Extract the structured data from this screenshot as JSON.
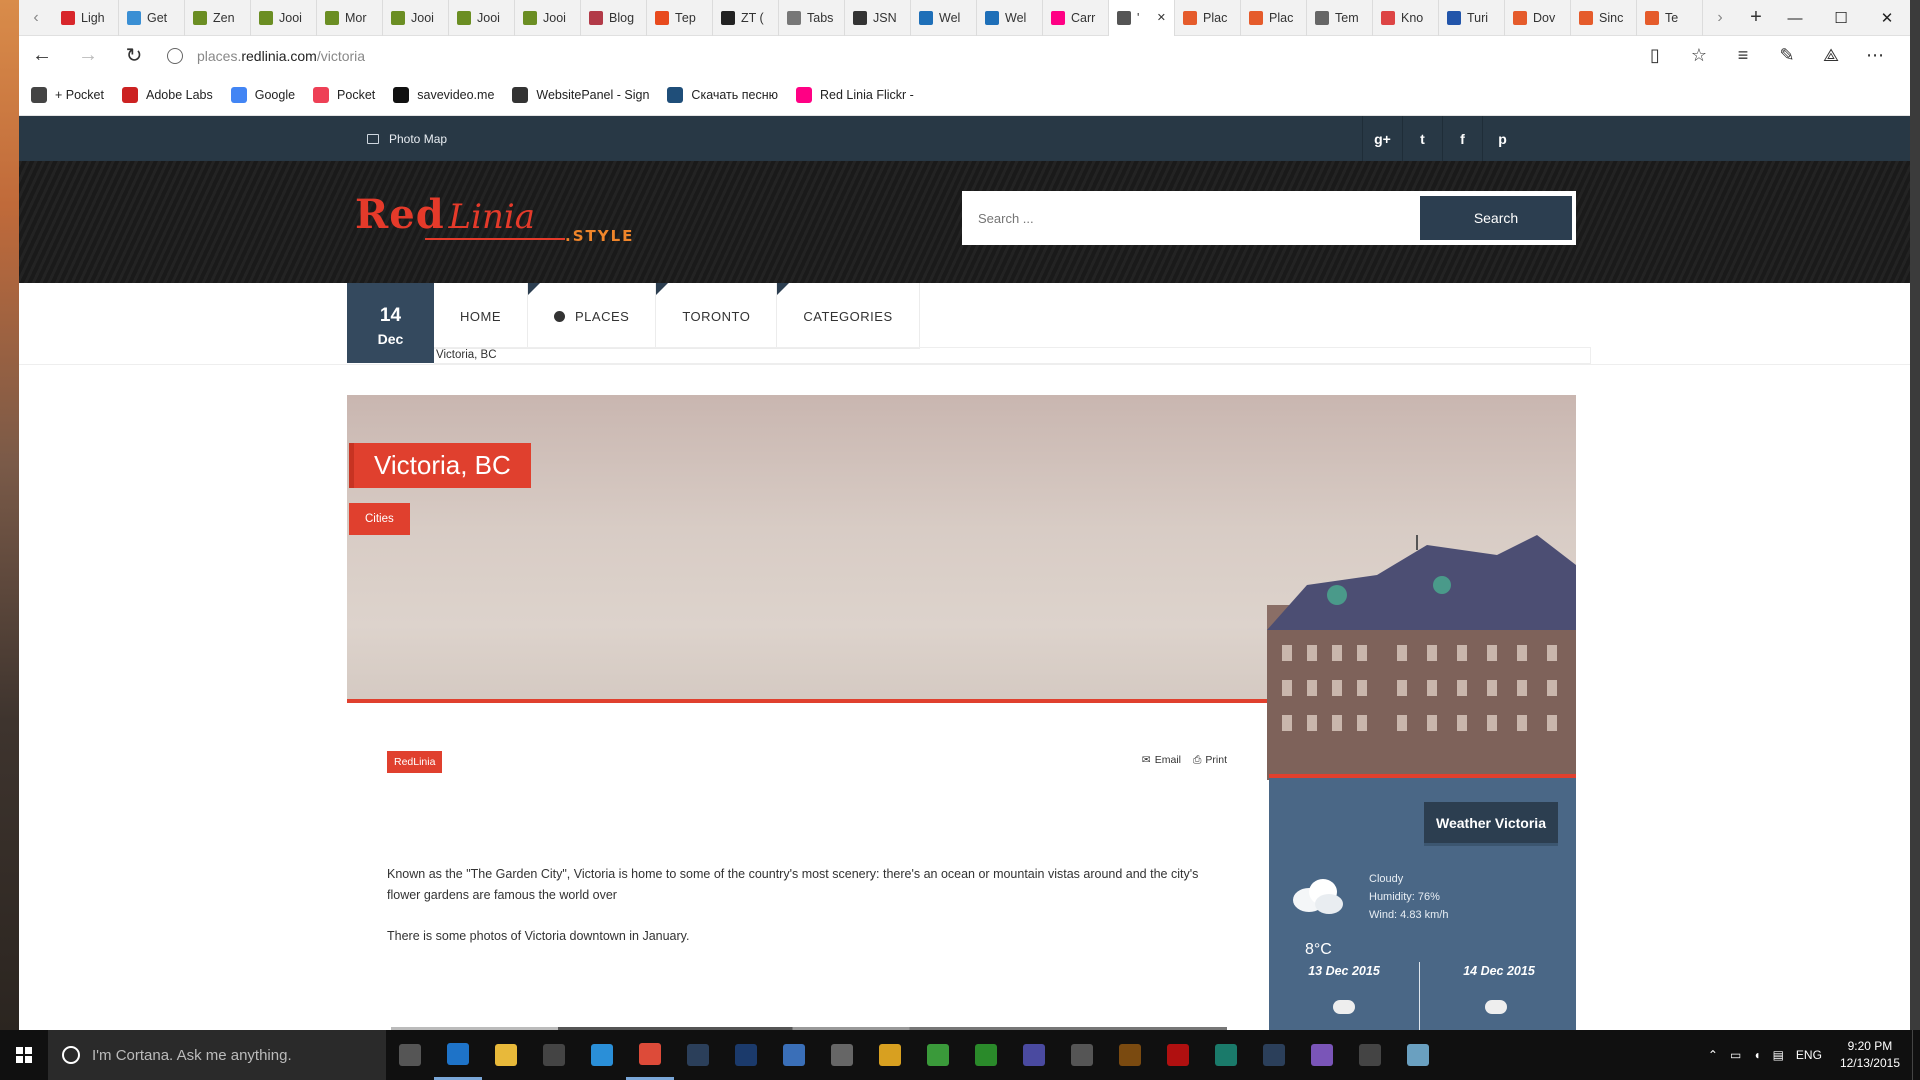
{
  "browser": {
    "tabs": [
      {
        "label": "Ligh",
        "color": "#d8262b"
      },
      {
        "label": "Get",
        "color": "#3a8fd4"
      },
      {
        "label": "Zen",
        "color": "#6b8e23"
      },
      {
        "label": "Jooi",
        "color": "#6b8e23"
      },
      {
        "label": "Mor",
        "color": "#6b8e23"
      },
      {
        "label": "Jooi",
        "color": "#6b8e23"
      },
      {
        "label": "Jooi",
        "color": "#6b8e23"
      },
      {
        "label": "Jooi",
        "color": "#6b8e23"
      },
      {
        "label": "Blog",
        "color": "#b23a48"
      },
      {
        "label": "Тер",
        "color": "#e84a1d"
      },
      {
        "label": "ZT (",
        "color": "#222222"
      },
      {
        "label": "Tabs",
        "color": "#777777"
      },
      {
        "label": "JSN",
        "color": "#333333"
      },
      {
        "label": "Wel",
        "color": "#1e6fb8"
      },
      {
        "label": "Wel",
        "color": "#1e6fb8"
      },
      {
        "label": "Carr",
        "color": "#ff0084"
      },
      {
        "label": "'",
        "color": "#555555"
      },
      {
        "label": "Plac",
        "color": "#e55b2b"
      },
      {
        "label": "Plac",
        "color": "#e55b2b"
      },
      {
        "label": "Tem",
        "color": "#666666"
      },
      {
        "label": "Kno",
        "color": "#d44"
      },
      {
        "label": "Turi",
        "color": "#2255aa"
      },
      {
        "label": "Dov",
        "color": "#e55b2b"
      },
      {
        "label": "Sinc",
        "color": "#e55b2b"
      },
      {
        "label": "Te",
        "color": "#e55b2b"
      }
    ],
    "active_tab_index": 16,
    "url_prefix": "places.",
    "url_domain": "redlinia.com",
    "url_path": "/victoria",
    "favorites": [
      {
        "label": "+ Pocket",
        "icon": "star-icon",
        "color": "#444444"
      },
      {
        "label": "Adobe Labs",
        "icon": "adobe-icon",
        "color": "#cc2222"
      },
      {
        "label": "Google",
        "icon": "google-icon",
        "color": "#4285f4"
      },
      {
        "label": "Pocket",
        "icon": "pocket-icon",
        "color": "#ee4056"
      },
      {
        "label": "savevideo.me",
        "icon": "savevideo-icon",
        "color": "#111111"
      },
      {
        "label": "WebsitePanel - Sign",
        "icon": "websitepanel-icon",
        "color": "#333333"
      },
      {
        "label": "Скачать песню",
        "icon": "music-icon",
        "color": "#1f4e79"
      },
      {
        "label": "Red Linia  Flickr -",
        "icon": "flickr-icon",
        "color": "#ff0084"
      }
    ]
  },
  "site": {
    "topbar": {
      "photo_map": "Photo Map"
    },
    "social": [
      "g+",
      "t",
      "f",
      "p"
    ],
    "logo": {
      "red": "Red",
      "linia": "Linia",
      "style": ".STYLE"
    },
    "search": {
      "placeholder": "Search ...",
      "button": "Search"
    },
    "date": {
      "day": "14",
      "month": "Dec"
    },
    "menu": [
      "HOME",
      "PLACES",
      "TORONTO",
      "CATEGORIES"
    ],
    "breadcrumb": "Victoria, BC",
    "hero": {
      "title": "Victoria, BC",
      "category": "Cities"
    },
    "article": {
      "tag": "RedLinia",
      "email": "Email",
      "print": "Print",
      "p1": "Known as the \"The Garden City\", Victoria is home to some of the country's most scenery: there's an ocean or mountain vistas around and the city's flower gardens are famous the world over",
      "p2": "There is some photos of Victoria downtown in  January."
    },
    "weather": {
      "title": "Weather Victoria",
      "condition": "Cloudy",
      "humidity": "Humidity: 76%",
      "wind": "Wind: 4.83 km/h",
      "temp": "8°C",
      "forecast": [
        "13 Dec 2015",
        "14 Dec 2015"
      ]
    }
  },
  "taskbar": {
    "cortana": "I'm Cortana. Ask me anything.",
    "time": "9:20 PM",
    "date": "12/13/2015",
    "lang": "ENG",
    "apps": [
      {
        "name": "task-view",
        "color": "#555"
      },
      {
        "name": "edge",
        "color": "#1e73c8"
      },
      {
        "name": "file-explorer",
        "color": "#e8b93a"
      },
      {
        "name": "store",
        "color": "#444"
      },
      {
        "name": "ie",
        "color": "#2a8fd8"
      },
      {
        "name": "chrome",
        "color": "#dd4b39"
      },
      {
        "name": "lightroom",
        "color": "#2b3f5a"
      },
      {
        "name": "photoshop",
        "color": "#1b3a6b"
      },
      {
        "name": "app-1",
        "color": "#3a6fb8"
      },
      {
        "name": "app-2",
        "color": "#666"
      },
      {
        "name": "app-3",
        "color": "#d8a020"
      },
      {
        "name": "app-4",
        "color": "#3a9a3a"
      },
      {
        "name": "app-5",
        "color": "#2a8a2a"
      },
      {
        "name": "app-6",
        "color": "#4a4aa0"
      },
      {
        "name": "app-7",
        "color": "#555"
      },
      {
        "name": "bridge",
        "color": "#7a4a10"
      },
      {
        "name": "filezilla",
        "color": "#b01010"
      },
      {
        "name": "app-8",
        "color": "#1a7a6a"
      },
      {
        "name": "lightroom-2",
        "color": "#2b3f5a"
      },
      {
        "name": "viber",
        "color": "#7a55b8"
      },
      {
        "name": "settings",
        "color": "#444"
      },
      {
        "name": "app-9",
        "color": "#6aa0c0"
      }
    ]
  }
}
